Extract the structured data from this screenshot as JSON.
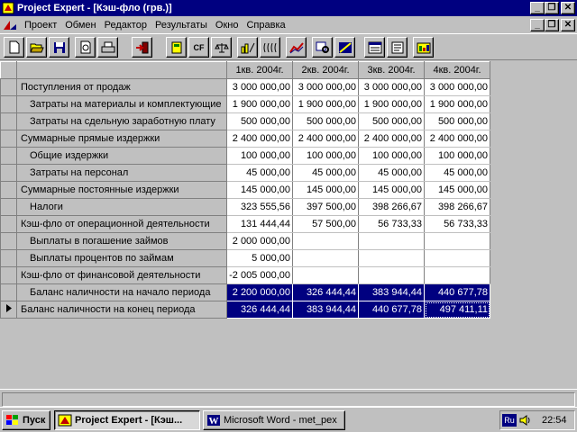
{
  "window": {
    "title": "Project Expert - [Кэш-фло (грв.)]",
    "app_buttons": [
      "_",
      "❐",
      "✕"
    ],
    "doc_buttons": [
      "_",
      "❐",
      "✕"
    ]
  },
  "menu": [
    {
      "label": "Проект"
    },
    {
      "label": "Обмен"
    },
    {
      "label": "Редактор"
    },
    {
      "label": "Результаты"
    },
    {
      "label": "Окно"
    },
    {
      "label": "Справка"
    }
  ],
  "toolbar": {
    "buttons": [
      {
        "name": "new-icon"
      },
      {
        "name": "open-icon"
      },
      {
        "name": "save-icon"
      },
      {
        "name": "preview-icon"
      },
      {
        "name": "print-icon"
      },
      {
        "name": "exit-icon"
      },
      {
        "name": "calculator-icon"
      },
      {
        "name": "cashflow-icon",
        "text": "CF"
      },
      {
        "name": "balance-icon"
      },
      {
        "name": "percent-icon"
      },
      {
        "name": "money-icon"
      },
      {
        "name": "chart-icon"
      },
      {
        "name": "analysis-icon"
      },
      {
        "name": "trend-icon"
      },
      {
        "name": "report-icon"
      },
      {
        "name": "document-icon"
      },
      {
        "name": "calendar-icon"
      }
    ]
  },
  "grid": {
    "columns": [
      "1кв. 2004г.",
      "2кв. 2004г.",
      "3кв. 2004г.",
      "4кв. 2004г."
    ],
    "rows": [
      {
        "label": "Поступления от продаж",
        "level": 1,
        "values": [
          "3 000 000,00",
          "3 000 000,00",
          "3 000 000,00",
          "3 000 000,00"
        ]
      },
      {
        "label": "Затраты на материалы и комплектующие",
        "level": 2,
        "values": [
          "1 900 000,00",
          "1 900 000,00",
          "1 900 000,00",
          "1 900 000,00"
        ]
      },
      {
        "label": "Затраты на сдельную заработную плату",
        "level": 2,
        "values": [
          "500 000,00",
          "500 000,00",
          "500 000,00",
          "500 000,00"
        ]
      },
      {
        "label": "Суммарные прямые издержки",
        "level": 1,
        "values": [
          "2 400 000,00",
          "2 400 000,00",
          "2 400 000,00",
          "2 400 000,00"
        ]
      },
      {
        "label": "Общие издержки",
        "level": 2,
        "values": [
          "100 000,00",
          "100 000,00",
          "100 000,00",
          "100 000,00"
        ]
      },
      {
        "label": "Затраты на персонал",
        "level": 2,
        "values": [
          "45 000,00",
          "45 000,00",
          "45 000,00",
          "45 000,00"
        ]
      },
      {
        "label": "Суммарные постоянные издержки",
        "level": 1,
        "values": [
          "145 000,00",
          "145 000,00",
          "145 000,00",
          "145 000,00"
        ]
      },
      {
        "label": "Налоги",
        "level": 2,
        "values": [
          "323 555,56",
          "397 500,00",
          "398 266,67",
          "398 266,67"
        ]
      },
      {
        "label": "Кэш-фло от операционной деятельности",
        "level": 1,
        "values": [
          "131 444,44",
          "57 500,00",
          "56 733,33",
          "56 733,33"
        ]
      },
      {
        "label": "Выплаты в погашение займов",
        "level": 2,
        "values": [
          "2 000 000,00",
          "",
          "",
          ""
        ]
      },
      {
        "label": "Выплаты процентов по займам",
        "level": 2,
        "values": [
          "5 000,00",
          "",
          "",
          ""
        ]
      },
      {
        "label": "Кэш-фло от финансовой деятельности",
        "level": 1,
        "values": [
          "-2 005 000,00",
          "",
          "",
          ""
        ]
      },
      {
        "label": "Баланс наличности на начало периода",
        "level": 2,
        "selected": true,
        "values": [
          "2 200 000,00",
          "326 444,44",
          "383 944,44",
          "440 677,78"
        ]
      },
      {
        "label": "Баланс наличности на конец периода",
        "level": 1,
        "selected": true,
        "current": true,
        "values": [
          "326 444,44",
          "383 944,44",
          "440 677,78",
          "497 411,11"
        ]
      }
    ]
  },
  "taskbar": {
    "start_label": "Пуск",
    "tasks": [
      {
        "label": "Project Expert - [Кэш...",
        "active": true
      },
      {
        "label": "Microsoft Word - met_pex",
        "active": false
      }
    ],
    "lang": "Ru",
    "clock": "22:54"
  }
}
